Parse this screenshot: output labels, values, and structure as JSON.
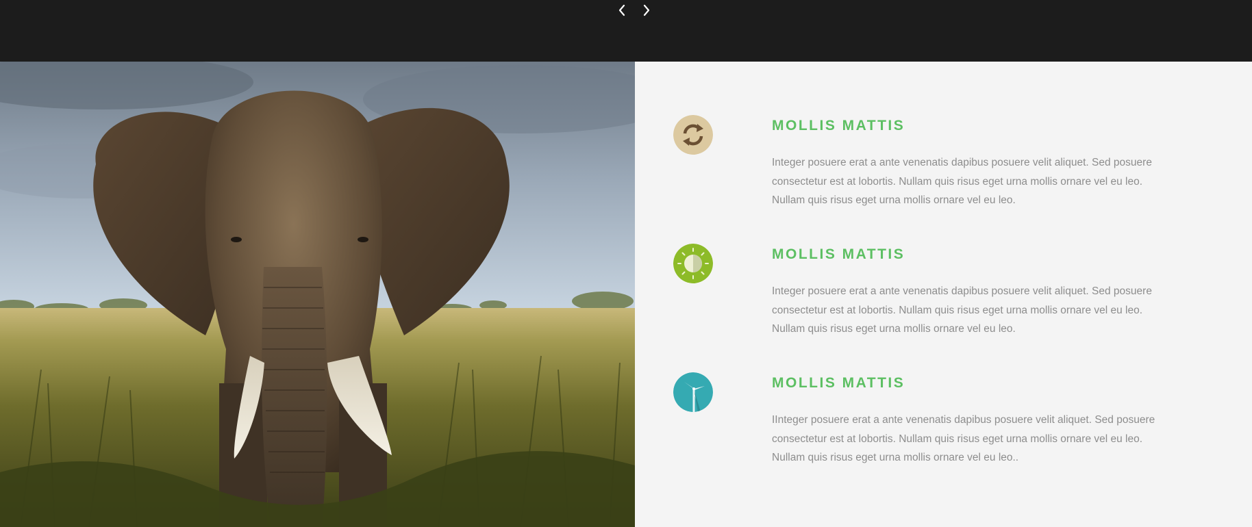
{
  "nav": {
    "prev_icon": "chevron-left-icon",
    "next_icon": "chevron-right-icon"
  },
  "hero": {
    "image": "elephant-in-grassland-photo"
  },
  "features": [
    {
      "icon": "recycle-icon",
      "icon_color": "#dcc9a0",
      "title": "MOLLIS MATTIS",
      "text": "Integer posuere erat a ante venenatis dapibus posuere velit aliquet. Sed posuere consectetur est at lobortis. Nullam quis risus eget urna mollis ornare vel eu leo. Nullam quis risus eget urna mollis ornare vel eu leo."
    },
    {
      "icon": "sun-icon",
      "icon_color": "#8dbb28",
      "title": "MOLLIS MATTIS",
      "text": "Integer posuere erat a ante venenatis dapibus posuere velit aliquet. Sed posuere consectetur est at lobortis. Nullam quis risus eget urna mollis ornare vel eu leo. Nullam quis risus eget urna mollis ornare vel eu leo."
    },
    {
      "icon": "wind-turbine-icon",
      "icon_color": "#35aab2",
      "title": "MOLLIS MATTIS",
      "text": "IInteger posuere erat a ante venenatis dapibus posuere velit aliquet. Sed posuere consectetur est at lobortis. Nullam quis risus eget urna mollis ornare vel eu leo. Nullam quis risus eget urna mollis ornare vel eu leo.."
    }
  ],
  "colors": {
    "top_bar": "#1c1c1c",
    "panel_background": "#f4f4f4",
    "title_green": "#5cbf62",
    "body_text": "#8d8d8d"
  }
}
